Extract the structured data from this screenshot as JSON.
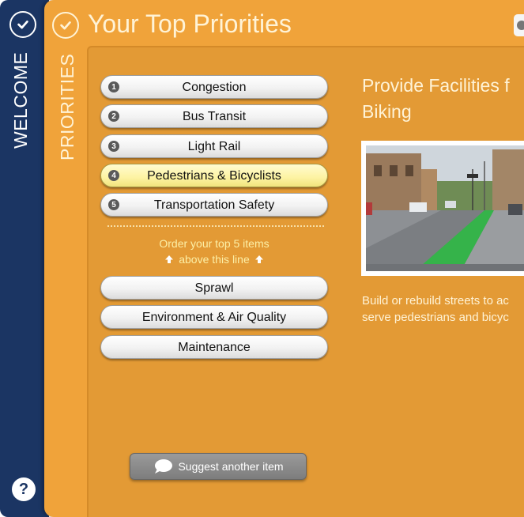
{
  "rail": {
    "label": "WELCOME",
    "help_label": "?"
  },
  "panel": {
    "title": "Your Top Priorities",
    "side_label": "PRIORITIES"
  },
  "priorities": {
    "ranked": [
      {
        "num": "1",
        "label": "Congestion"
      },
      {
        "num": "2",
        "label": "Bus Transit"
      },
      {
        "num": "3",
        "label": "Light Rail"
      },
      {
        "num": "4",
        "label": "Pedestrians & Bicyclists",
        "selected": true
      },
      {
        "num": "5",
        "label": "Transportation Safety"
      }
    ],
    "instruction_line1": "Order your top 5 items",
    "instruction_line2": "above this line",
    "unranked": [
      {
        "label": "Sprawl"
      },
      {
        "label": "Environment & Air Quality"
      },
      {
        "label": "Maintenance"
      }
    ],
    "suggest_label": "Suggest another item"
  },
  "detail": {
    "title_line1": "Provide Facilities f",
    "title_line2": "Biking",
    "desc_line1": "Build or rebuild streets to ac",
    "desc_line2": "serve pedestrians and bicyc"
  },
  "colors": {
    "navy": "#1b3563",
    "orange": "#f0a33a",
    "highlight": "#fdf3a2"
  },
  "icons": [
    "check-icon",
    "question-icon",
    "close-icon",
    "arrow-up-icon",
    "speech-bubble-icon"
  ]
}
